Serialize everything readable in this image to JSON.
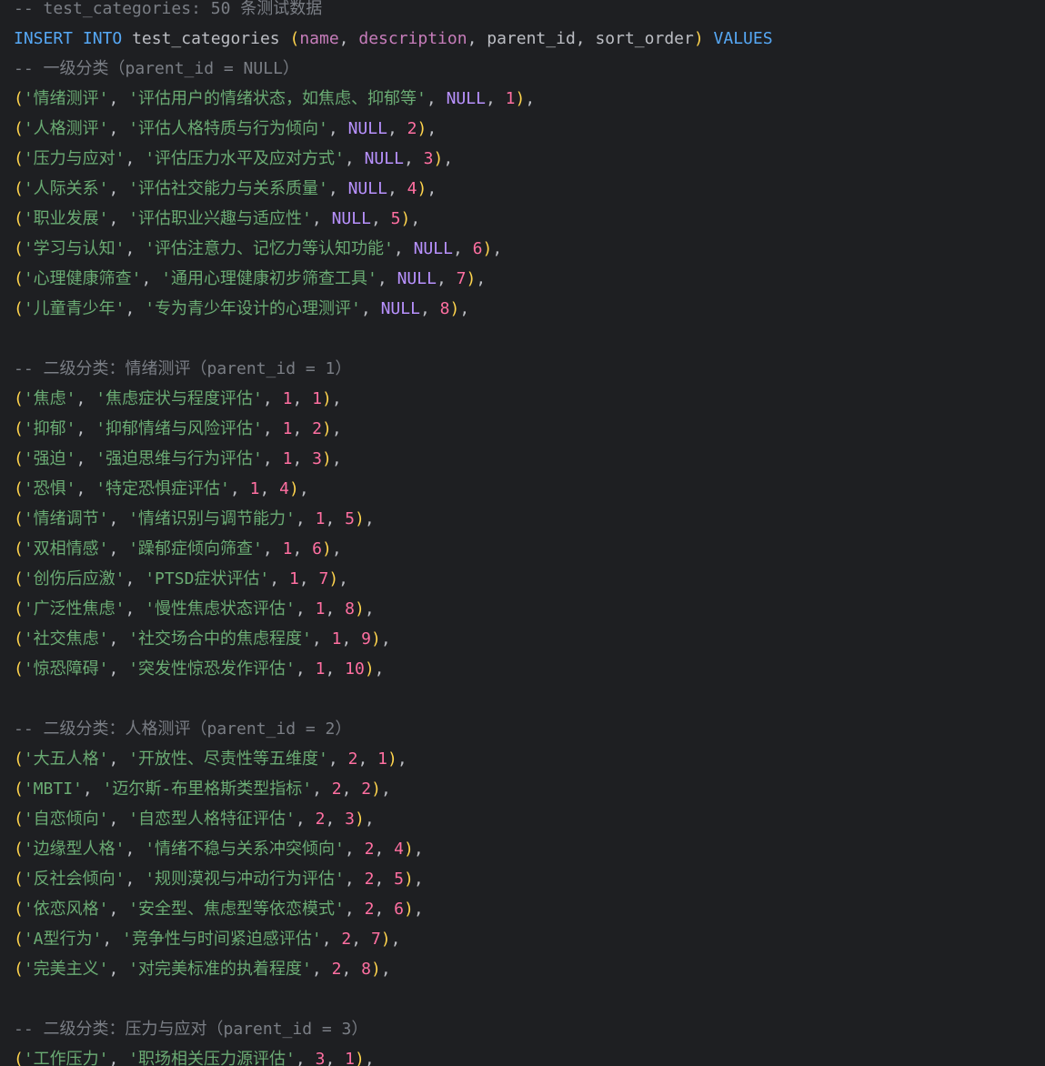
{
  "lines": [
    [
      [
        "-- test_categories: 50 条测试数据",
        "cmt"
      ]
    ],
    [
      [
        "INSERT",
        "kw"
      ],
      [
        " ",
        "pl"
      ],
      [
        "INTO",
        "kw"
      ],
      [
        " test_categories ",
        "pl"
      ],
      [
        "(",
        "par"
      ],
      [
        "name",
        "col"
      ],
      [
        ", ",
        "pl"
      ],
      [
        "description",
        "col"
      ],
      [
        ", parent_id, sort_order",
        "pl"
      ],
      [
        ")",
        "par"
      ],
      [
        " ",
        "pl"
      ],
      [
        "VALUES",
        "kw"
      ]
    ],
    [
      [
        "-- 一级分类（parent_id = NULL）",
        "cmt"
      ]
    ],
    [
      [
        "(",
        "par"
      ],
      [
        "'情绪测评'",
        "str"
      ],
      [
        ", ",
        "pl"
      ],
      [
        "'评估用户的情绪状态，如焦虑、抑郁等'",
        "str"
      ],
      [
        ", ",
        "pl"
      ],
      [
        "NULL",
        "nul"
      ],
      [
        ", ",
        "pl"
      ],
      [
        "1",
        "num"
      ],
      [
        ")",
        "par"
      ],
      [
        ",",
        "pl"
      ]
    ],
    [
      [
        "(",
        "par"
      ],
      [
        "'人格测评'",
        "str"
      ],
      [
        ", ",
        "pl"
      ],
      [
        "'评估人格特质与行为倾向'",
        "str"
      ],
      [
        ", ",
        "pl"
      ],
      [
        "NULL",
        "nul"
      ],
      [
        ", ",
        "pl"
      ],
      [
        "2",
        "num"
      ],
      [
        ")",
        "par"
      ],
      [
        ",",
        "pl"
      ]
    ],
    [
      [
        "(",
        "par"
      ],
      [
        "'压力与应对'",
        "str"
      ],
      [
        ", ",
        "pl"
      ],
      [
        "'评估压力水平及应对方式'",
        "str"
      ],
      [
        ", ",
        "pl"
      ],
      [
        "NULL",
        "nul"
      ],
      [
        ", ",
        "pl"
      ],
      [
        "3",
        "num"
      ],
      [
        ")",
        "par"
      ],
      [
        ",",
        "pl"
      ]
    ],
    [
      [
        "(",
        "par"
      ],
      [
        "'人际关系'",
        "str"
      ],
      [
        ", ",
        "pl"
      ],
      [
        "'评估社交能力与关系质量'",
        "str"
      ],
      [
        ", ",
        "pl"
      ],
      [
        "NULL",
        "nul"
      ],
      [
        ", ",
        "pl"
      ],
      [
        "4",
        "num"
      ],
      [
        ")",
        "par"
      ],
      [
        ",",
        "pl"
      ]
    ],
    [
      [
        "(",
        "par"
      ],
      [
        "'职业发展'",
        "str"
      ],
      [
        ", ",
        "pl"
      ],
      [
        "'评估职业兴趣与适应性'",
        "str"
      ],
      [
        ", ",
        "pl"
      ],
      [
        "NULL",
        "nul"
      ],
      [
        ", ",
        "pl"
      ],
      [
        "5",
        "num"
      ],
      [
        ")",
        "par"
      ],
      [
        ",",
        "pl"
      ]
    ],
    [
      [
        "(",
        "par"
      ],
      [
        "'学习与认知'",
        "str"
      ],
      [
        ", ",
        "pl"
      ],
      [
        "'评估注意力、记忆力等认知功能'",
        "str"
      ],
      [
        ", ",
        "pl"
      ],
      [
        "NULL",
        "nul"
      ],
      [
        ", ",
        "pl"
      ],
      [
        "6",
        "num"
      ],
      [
        ")",
        "par"
      ],
      [
        ",",
        "pl"
      ]
    ],
    [
      [
        "(",
        "par"
      ],
      [
        "'心理健康筛查'",
        "str"
      ],
      [
        ", ",
        "pl"
      ],
      [
        "'通用心理健康初步筛查工具'",
        "str"
      ],
      [
        ", ",
        "pl"
      ],
      [
        "NULL",
        "nul"
      ],
      [
        ", ",
        "pl"
      ],
      [
        "7",
        "num"
      ],
      [
        ")",
        "par"
      ],
      [
        ",",
        "pl"
      ]
    ],
    [
      [
        "(",
        "par"
      ],
      [
        "'儿童青少年'",
        "str"
      ],
      [
        ", ",
        "pl"
      ],
      [
        "'专为青少年设计的心理测评'",
        "str"
      ],
      [
        ", ",
        "pl"
      ],
      [
        "NULL",
        "nul"
      ],
      [
        ", ",
        "pl"
      ],
      [
        "8",
        "num"
      ],
      [
        ")",
        "par"
      ],
      [
        ",",
        "pl"
      ]
    ],
    [],
    [
      [
        "-- 二级分类：情绪测评（parent_id = 1）",
        "cmt"
      ]
    ],
    [
      [
        "(",
        "par"
      ],
      [
        "'焦虑'",
        "str"
      ],
      [
        ", ",
        "pl"
      ],
      [
        "'焦虑症状与程度评估'",
        "str"
      ],
      [
        ", ",
        "pl"
      ],
      [
        "1",
        "num"
      ],
      [
        ", ",
        "pl"
      ],
      [
        "1",
        "num"
      ],
      [
        ")",
        "par"
      ],
      [
        ",",
        "pl"
      ]
    ],
    [
      [
        "(",
        "par"
      ],
      [
        "'抑郁'",
        "str"
      ],
      [
        ", ",
        "pl"
      ],
      [
        "'抑郁情绪与风险评估'",
        "str"
      ],
      [
        ", ",
        "pl"
      ],
      [
        "1",
        "num"
      ],
      [
        ", ",
        "pl"
      ],
      [
        "2",
        "num"
      ],
      [
        ")",
        "par"
      ],
      [
        ",",
        "pl"
      ]
    ],
    [
      [
        "(",
        "par"
      ],
      [
        "'强迫'",
        "str"
      ],
      [
        ", ",
        "pl"
      ],
      [
        "'强迫思维与行为评估'",
        "str"
      ],
      [
        ", ",
        "pl"
      ],
      [
        "1",
        "num"
      ],
      [
        ", ",
        "pl"
      ],
      [
        "3",
        "num"
      ],
      [
        ")",
        "par"
      ],
      [
        ",",
        "pl"
      ]
    ],
    [
      [
        "(",
        "par"
      ],
      [
        "'恐惧'",
        "str"
      ],
      [
        ", ",
        "pl"
      ],
      [
        "'特定恐惧症评估'",
        "str"
      ],
      [
        ", ",
        "pl"
      ],
      [
        "1",
        "num"
      ],
      [
        ", ",
        "pl"
      ],
      [
        "4",
        "num"
      ],
      [
        ")",
        "par"
      ],
      [
        ",",
        "pl"
      ]
    ],
    [
      [
        "(",
        "par"
      ],
      [
        "'情绪调节'",
        "str"
      ],
      [
        ", ",
        "pl"
      ],
      [
        "'情绪识别与调节能力'",
        "str"
      ],
      [
        ", ",
        "pl"
      ],
      [
        "1",
        "num"
      ],
      [
        ", ",
        "pl"
      ],
      [
        "5",
        "num"
      ],
      [
        ")",
        "par"
      ],
      [
        ",",
        "pl"
      ]
    ],
    [
      [
        "(",
        "par"
      ],
      [
        "'双相情感'",
        "str"
      ],
      [
        ", ",
        "pl"
      ],
      [
        "'躁郁症倾向筛查'",
        "str"
      ],
      [
        ", ",
        "pl"
      ],
      [
        "1",
        "num"
      ],
      [
        ", ",
        "pl"
      ],
      [
        "6",
        "num"
      ],
      [
        ")",
        "par"
      ],
      [
        ",",
        "pl"
      ]
    ],
    [
      [
        "(",
        "par"
      ],
      [
        "'创伤后应激'",
        "str"
      ],
      [
        ", ",
        "pl"
      ],
      [
        "'PTSD症状评估'",
        "str"
      ],
      [
        ", ",
        "pl"
      ],
      [
        "1",
        "num"
      ],
      [
        ", ",
        "pl"
      ],
      [
        "7",
        "num"
      ],
      [
        ")",
        "par"
      ],
      [
        ",",
        "pl"
      ]
    ],
    [
      [
        "(",
        "par"
      ],
      [
        "'广泛性焦虑'",
        "str"
      ],
      [
        ", ",
        "pl"
      ],
      [
        "'慢性焦虑状态评估'",
        "str"
      ],
      [
        ", ",
        "pl"
      ],
      [
        "1",
        "num"
      ],
      [
        ", ",
        "pl"
      ],
      [
        "8",
        "num"
      ],
      [
        ")",
        "par"
      ],
      [
        ",",
        "pl"
      ]
    ],
    [
      [
        "(",
        "par"
      ],
      [
        "'社交焦虑'",
        "str"
      ],
      [
        ", ",
        "pl"
      ],
      [
        "'社交场合中的焦虑程度'",
        "str"
      ],
      [
        ", ",
        "pl"
      ],
      [
        "1",
        "num"
      ],
      [
        ", ",
        "pl"
      ],
      [
        "9",
        "num"
      ],
      [
        ")",
        "par"
      ],
      [
        ",",
        "pl"
      ]
    ],
    [
      [
        "(",
        "par"
      ],
      [
        "'惊恐障碍'",
        "str"
      ],
      [
        ", ",
        "pl"
      ],
      [
        "'突发性惊恐发作评估'",
        "str"
      ],
      [
        ", ",
        "pl"
      ],
      [
        "1",
        "num"
      ],
      [
        ", ",
        "pl"
      ],
      [
        "10",
        "num"
      ],
      [
        ")",
        "par"
      ],
      [
        ",",
        "pl"
      ]
    ],
    [],
    [
      [
        "-- 二级分类：人格测评（parent_id = 2）",
        "cmt"
      ]
    ],
    [
      [
        "(",
        "par"
      ],
      [
        "'大五人格'",
        "str"
      ],
      [
        ", ",
        "pl"
      ],
      [
        "'开放性、尽责性等五维度'",
        "str"
      ],
      [
        ", ",
        "pl"
      ],
      [
        "2",
        "num"
      ],
      [
        ", ",
        "pl"
      ],
      [
        "1",
        "num"
      ],
      [
        ")",
        "par"
      ],
      [
        ",",
        "pl"
      ]
    ],
    [
      [
        "(",
        "par"
      ],
      [
        "'MBTI'",
        "str"
      ],
      [
        ", ",
        "pl"
      ],
      [
        "'迈尔斯-布里格斯类型指标'",
        "str"
      ],
      [
        ", ",
        "pl"
      ],
      [
        "2",
        "num"
      ],
      [
        ", ",
        "pl"
      ],
      [
        "2",
        "num"
      ],
      [
        ")",
        "par"
      ],
      [
        ",",
        "pl"
      ]
    ],
    [
      [
        "(",
        "par"
      ],
      [
        "'自恋倾向'",
        "str"
      ],
      [
        ", ",
        "pl"
      ],
      [
        "'自恋型人格特征评估'",
        "str"
      ],
      [
        ", ",
        "pl"
      ],
      [
        "2",
        "num"
      ],
      [
        ", ",
        "pl"
      ],
      [
        "3",
        "num"
      ],
      [
        ")",
        "par"
      ],
      [
        ",",
        "pl"
      ]
    ],
    [
      [
        "(",
        "par"
      ],
      [
        "'边缘型人格'",
        "str"
      ],
      [
        ", ",
        "pl"
      ],
      [
        "'情绪不稳与关系冲突倾向'",
        "str"
      ],
      [
        ", ",
        "pl"
      ],
      [
        "2",
        "num"
      ],
      [
        ", ",
        "pl"
      ],
      [
        "4",
        "num"
      ],
      [
        ")",
        "par"
      ],
      [
        ",",
        "pl"
      ]
    ],
    [
      [
        "(",
        "par"
      ],
      [
        "'反社会倾向'",
        "str"
      ],
      [
        ", ",
        "pl"
      ],
      [
        "'规则漠视与冲动行为评估'",
        "str"
      ],
      [
        ", ",
        "pl"
      ],
      [
        "2",
        "num"
      ],
      [
        ", ",
        "pl"
      ],
      [
        "5",
        "num"
      ],
      [
        ")",
        "par"
      ],
      [
        ",",
        "pl"
      ]
    ],
    [
      [
        "(",
        "par"
      ],
      [
        "'依恋风格'",
        "str"
      ],
      [
        ", ",
        "pl"
      ],
      [
        "'安全型、焦虑型等依恋模式'",
        "str"
      ],
      [
        ", ",
        "pl"
      ],
      [
        "2",
        "num"
      ],
      [
        ", ",
        "pl"
      ],
      [
        "6",
        "num"
      ],
      [
        ")",
        "par"
      ],
      [
        ",",
        "pl"
      ]
    ],
    [
      [
        "(",
        "par"
      ],
      [
        "'A型行为'",
        "str"
      ],
      [
        ", ",
        "pl"
      ],
      [
        "'竞争性与时间紧迫感评估'",
        "str"
      ],
      [
        ", ",
        "pl"
      ],
      [
        "2",
        "num"
      ],
      [
        ", ",
        "pl"
      ],
      [
        "7",
        "num"
      ],
      [
        ")",
        "par"
      ],
      [
        ",",
        "pl"
      ]
    ],
    [
      [
        "(",
        "par"
      ],
      [
        "'完美主义'",
        "str"
      ],
      [
        ", ",
        "pl"
      ],
      [
        "'对完美标准的执着程度'",
        "str"
      ],
      [
        ", ",
        "pl"
      ],
      [
        "2",
        "num"
      ],
      [
        ", ",
        "pl"
      ],
      [
        "8",
        "num"
      ],
      [
        ")",
        "par"
      ],
      [
        ",",
        "pl"
      ]
    ],
    [],
    [
      [
        "-- 二级分类：压力与应对（parent_id = 3）",
        "cmt"
      ]
    ],
    [
      [
        "(",
        "par"
      ],
      [
        "'工作压力'",
        "str"
      ],
      [
        ", ",
        "pl"
      ],
      [
        "'职场相关压力源评估'",
        "str"
      ],
      [
        ", ",
        "pl"
      ],
      [
        "3",
        "num"
      ],
      [
        ", ",
        "pl"
      ],
      [
        "1",
        "num"
      ],
      [
        ")",
        "par"
      ],
      [
        ",",
        "pl"
      ]
    ]
  ]
}
